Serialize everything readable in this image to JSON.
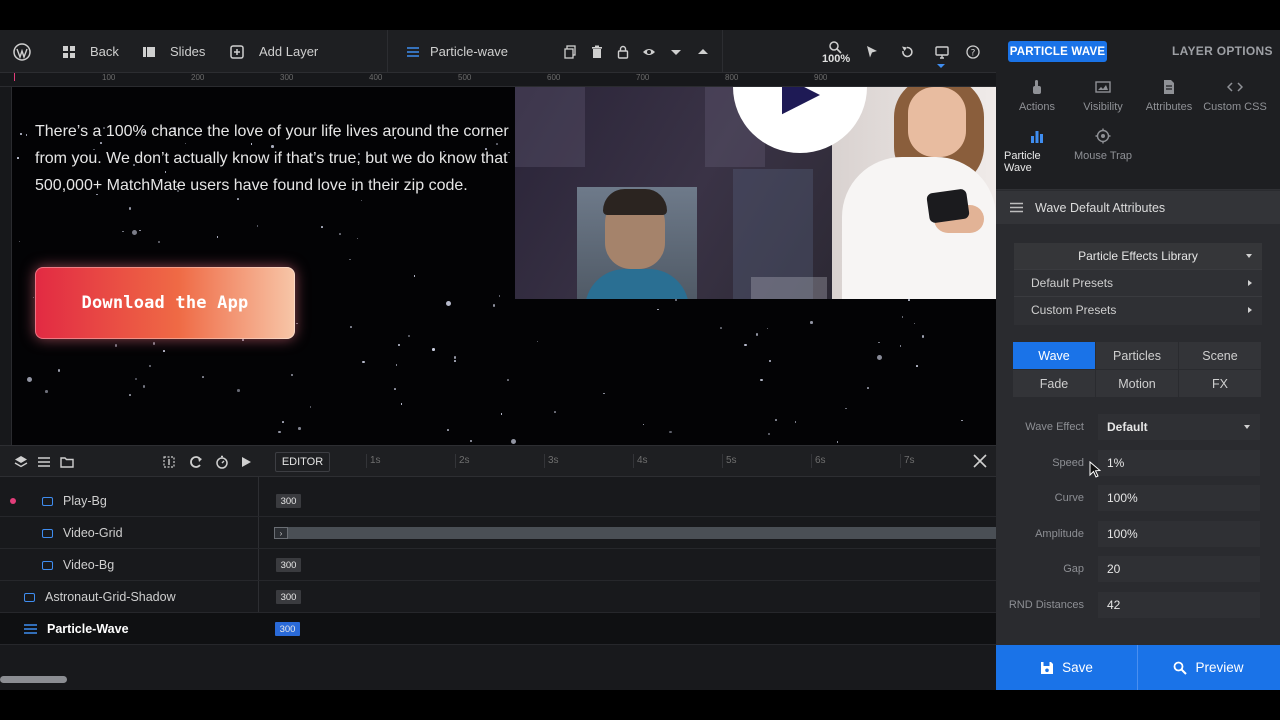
{
  "toolbar": {
    "back": "Back",
    "slides": "Slides",
    "add_layer": "Add Layer",
    "layer_name": "Particle-wave",
    "zoom": "100%"
  },
  "ruler": {
    "ticks": [
      "100",
      "200",
      "300",
      "400",
      "500",
      "600",
      "700",
      "800",
      "900"
    ]
  },
  "canvas": {
    "hero_text": "There’s a 100% chance the love of your life lives around the corner from you. We don’t actually know if that’s true, but we do know that 500,000+ MatchMate users have found love in their zip code.",
    "cta_label": "Download the App"
  },
  "timeline": {
    "editor_tab": "EDITOR",
    "times": [
      "1s",
      "2s",
      "3s",
      "4s",
      "5s",
      "6s",
      "7s"
    ],
    "rows": [
      {
        "name": "Play-Bg",
        "badge": "300"
      },
      {
        "name": "Video-Grid",
        "badge": ""
      },
      {
        "name": "Video-Bg",
        "badge": "300"
      },
      {
        "name": "Astronaut-Grid-Shadow",
        "badge": "300"
      },
      {
        "name": "Particle-Wave",
        "badge": "300"
      }
    ]
  },
  "panel": {
    "pill": "PARTICLE WAVE",
    "layer_options": "LAYER OPTIONS",
    "tabs": [
      "Actions",
      "Visibility",
      "Attributes",
      "Custom CSS",
      "Particle Wave",
      "Mouse Trap"
    ],
    "section_title": "Wave Default Attributes",
    "library": {
      "title": "Particle Effects Library",
      "rows": [
        "Default Presets",
        "Custom Presets"
      ]
    },
    "fx_tabs": [
      "Wave",
      "Particles",
      "Scene",
      "Fade",
      "Motion",
      "FX"
    ],
    "fields": [
      {
        "label": "Wave Effect",
        "value": "Default"
      },
      {
        "label": "Speed",
        "value": "1%"
      },
      {
        "label": "Curve",
        "value": "100%"
      },
      {
        "label": "Amplitude",
        "value": "100%"
      },
      {
        "label": "Gap",
        "value": "20"
      },
      {
        "label": "RND Distances",
        "value": "42"
      }
    ],
    "save": "Save",
    "preview": "Preview"
  },
  "colors": {
    "accent": "#1a73e8",
    "toolbar_bg": "#1e1f22",
    "panel_bg": "#2a2b2f",
    "cta_start": "#e22a43",
    "cta_end": "#f7c6a8"
  }
}
